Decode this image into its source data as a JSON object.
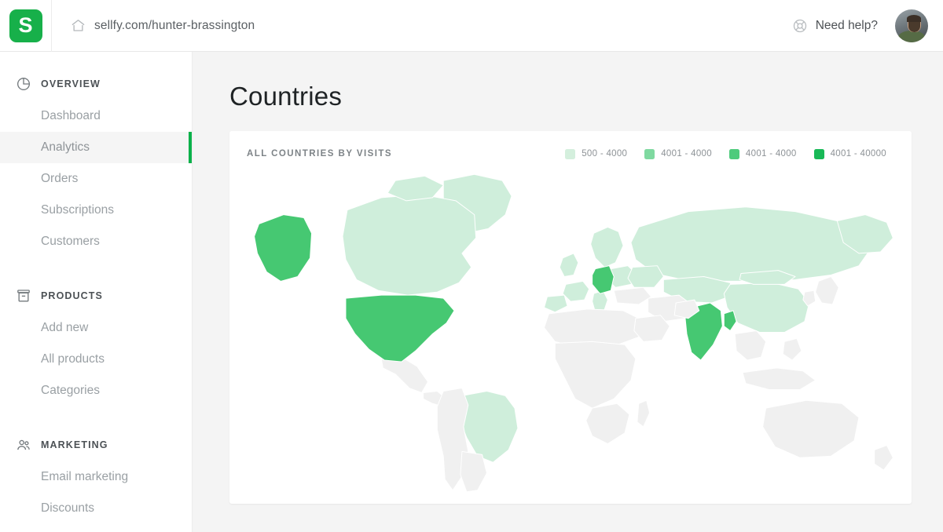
{
  "topbar": {
    "logo_letter": "S",
    "logo_icon": "sellfy-logo",
    "home_icon": "home-icon",
    "store_url": "sellfy.com/hunter-brassington",
    "help_icon": "lifebuoy-icon",
    "help_label": "Need help?",
    "avatar_icon": "user-avatar"
  },
  "sidebar": {
    "groups": [
      {
        "icon": "pie-chart-icon",
        "label": "OVERVIEW",
        "items": [
          {
            "label": "Dashboard",
            "active": false
          },
          {
            "label": "Analytics",
            "active": true
          },
          {
            "label": "Orders",
            "active": false
          },
          {
            "label": "Subscriptions",
            "active": false
          },
          {
            "label": "Customers",
            "active": false
          }
        ]
      },
      {
        "icon": "box-icon",
        "label": "PRODUCTS",
        "items": [
          {
            "label": "Add new",
            "active": false
          },
          {
            "label": "All products",
            "active": false
          },
          {
            "label": "Categories",
            "active": false
          }
        ]
      },
      {
        "icon": "people-icon",
        "label": "MARKETING",
        "items": [
          {
            "label": "Email marketing",
            "active": false
          },
          {
            "label": "Discounts",
            "active": false
          }
        ]
      }
    ]
  },
  "main": {
    "page_title": "Countries",
    "card": {
      "title": "ALL COUNTRIES BY VISITS",
      "legend": [
        {
          "label": "500 - 4000",
          "color": "#d4efdd"
        },
        {
          "label": "4001 - 4000",
          "color": "#7fd9a0"
        },
        {
          "label": "4001 - 4000",
          "color": "#4ecb7c"
        },
        {
          "label": "4001 - 40000",
          "color": "#19b957"
        }
      ]
    }
  },
  "colors": {
    "accent": "#0ab14a",
    "logo_green": "#17b04a",
    "map_bg": "#ffffff",
    "map_default": "#f0f0f0",
    "map_light": "#cfeedb",
    "map_dark": "#46c872",
    "card_bg": "#ffffff",
    "main_bg": "#f4f4f4"
  },
  "chart_data": {
    "type": "map",
    "title": "ALL COUNTRIES BY VISITS",
    "metric": "visits",
    "legend_position": "top-right",
    "bins": [
      {
        "label": "500 - 4000",
        "color": "#d4efdd"
      },
      {
        "label": "4001 - 4000",
        "color": "#7fd9a0"
      },
      {
        "label": "4001 - 4000",
        "color": "#4ecb7c"
      },
      {
        "label": "4001 - 40000",
        "color": "#19b957"
      }
    ],
    "regions": [
      {
        "name": "United States",
        "level": "dark",
        "color": "#46c872"
      },
      {
        "name": "Alaska",
        "level": "dark",
        "color": "#46c872"
      },
      {
        "name": "Germany",
        "level": "dark",
        "color": "#46c872"
      },
      {
        "name": "India",
        "level": "dark",
        "color": "#46c872"
      },
      {
        "name": "Bangladesh",
        "level": "dark",
        "color": "#46c872"
      },
      {
        "name": "Canada",
        "level": "light",
        "color": "#cfeedb"
      },
      {
        "name": "Greenland",
        "level": "light",
        "color": "#cfeedb"
      },
      {
        "name": "Mexico",
        "level": "light",
        "color": "#cfeedb"
      },
      {
        "name": "Brazil",
        "level": "light",
        "color": "#cfeedb"
      },
      {
        "name": "Russia",
        "level": "light",
        "color": "#cfeedb"
      },
      {
        "name": "China",
        "level": "light",
        "color": "#cfeedb"
      },
      {
        "name": "Sweden",
        "level": "light",
        "color": "#cfeedb"
      },
      {
        "name": "Norway",
        "level": "light",
        "color": "#cfeedb"
      },
      {
        "name": "Finland",
        "level": "light",
        "color": "#cfeedb"
      },
      {
        "name": "United Kingdom",
        "level": "light",
        "color": "#cfeedb"
      },
      {
        "name": "France",
        "level": "light",
        "color": "#cfeedb"
      },
      {
        "name": "Poland",
        "level": "light",
        "color": "#cfeedb"
      },
      {
        "name": "Italy",
        "level": "light",
        "color": "#cfeedb"
      },
      {
        "name": "Rest of world",
        "level": "none",
        "color": "#f0f0f0"
      }
    ]
  }
}
